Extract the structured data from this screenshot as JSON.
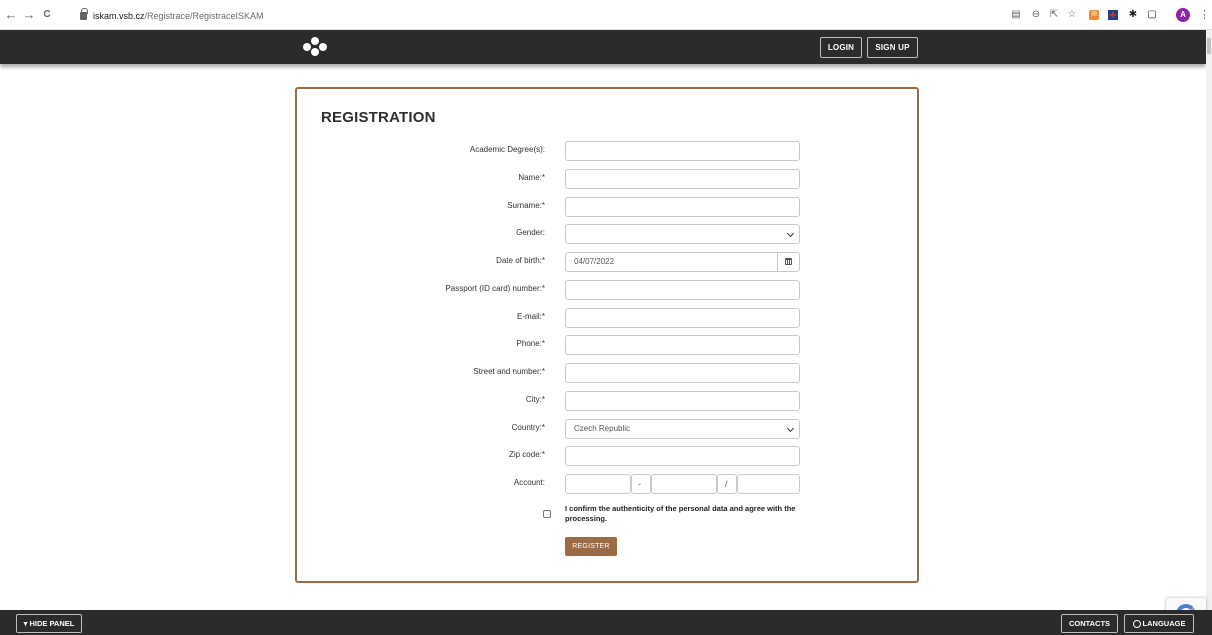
{
  "browser": {
    "back": "←",
    "forward": "→",
    "reload": "C",
    "url_host": "iskam.vsb.cz",
    "url_path": "/Registrace/RegistraceISKAM",
    "avatar_letter": "A"
  },
  "header": {
    "login_label": "LOGIN",
    "signup_label": "SIGN UP"
  },
  "form": {
    "title": "REGISTRATION",
    "fields": {
      "degree_label": "Academic Degree(s):",
      "name_label": "Name:*",
      "surname_label": "Surname:*",
      "gender_label": "Gender:",
      "dob_label": "Date of birth:*",
      "dob_value": "04/07/2022",
      "passport_label": "Passport (ID card) number:*",
      "email_label": "E-mail:*",
      "phone_label": "Phone:*",
      "street_label": "Street and number:*",
      "city_label": "City:*",
      "country_label": "Country:*",
      "country_value": "Czech Republic",
      "zip_label": "Zip code:*",
      "account_label": "Account:",
      "account_sep1": "-",
      "account_sep2": "/"
    },
    "confirm_text": "I confirm the authenticity of the personal data and agree with the processing.",
    "register_label": "REGISTER"
  },
  "footer": {
    "hide_panel_label": "▾ HIDE PANEL",
    "contacts_label": "CONTACTS",
    "language_label": "LANGUAGE"
  },
  "colors": {
    "accent": "#9a6b45",
    "header_bg": "#2b2b2b"
  }
}
